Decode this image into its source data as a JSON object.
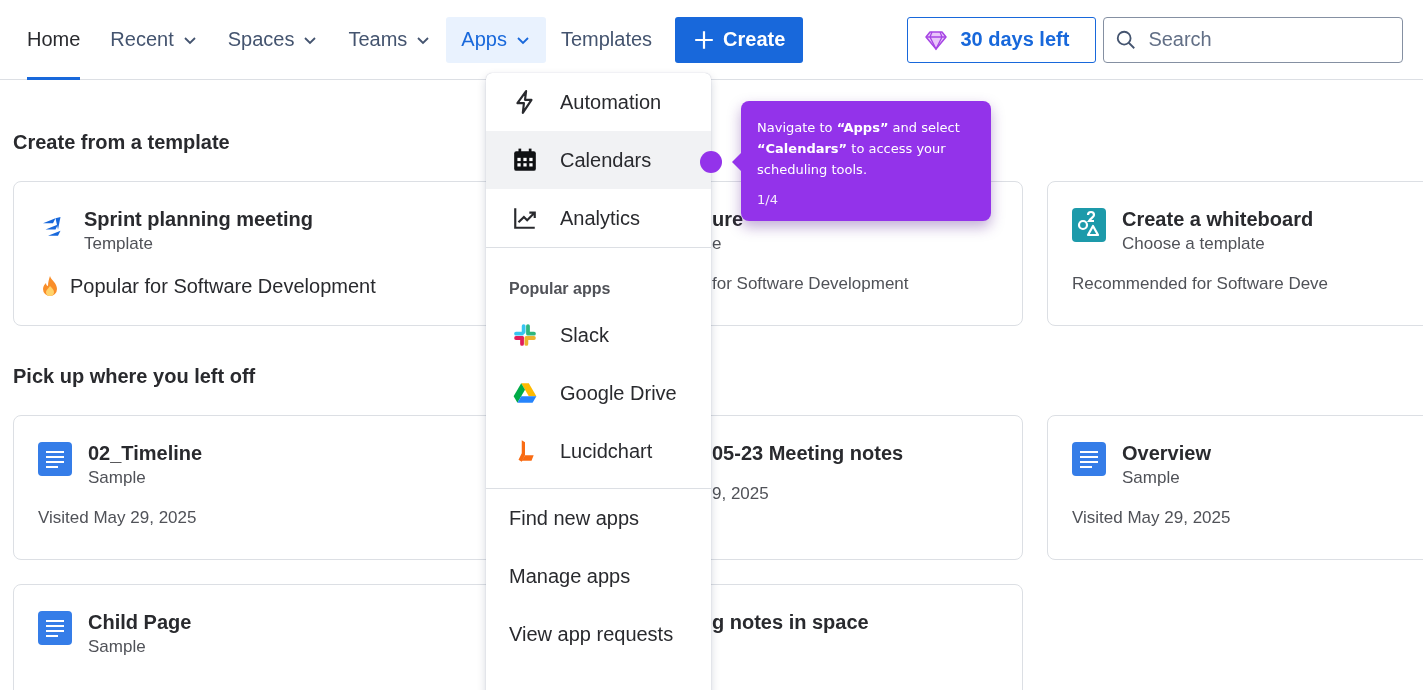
{
  "nav": {
    "items": [
      {
        "label": "Home",
        "caret": false,
        "selected": true,
        "expanded": false
      },
      {
        "label": "Recent",
        "caret": true,
        "selected": false,
        "expanded": false
      },
      {
        "label": "Spaces",
        "caret": true,
        "selected": false,
        "expanded": false
      },
      {
        "label": "Teams",
        "caret": true,
        "selected": false,
        "expanded": false
      },
      {
        "label": "Apps",
        "caret": true,
        "selected": false,
        "expanded": true
      },
      {
        "label": "Templates",
        "caret": false,
        "selected": false,
        "expanded": false
      }
    ],
    "create_button": "Create",
    "trial_badge": "30 days left",
    "search": {
      "placeholder": "Search"
    }
  },
  "sections": [
    {
      "title": "Create from a template",
      "rows": [
        [
          {
            "kind": "template",
            "title": "Sprint planning meeting",
            "subtitle": "Template",
            "footer": "Popular for Software Development",
            "footer_icon": true
          },
          {
            "kind": "hidden",
            "title": "ure",
            "subtitle": "e",
            "footer": "for Software Development",
            "footer_icon": false
          },
          {
            "kind": "whiteboard",
            "title": "Create a whiteboard",
            "subtitle": "Choose a template",
            "footer": "Recommended for Software Deve",
            "footer_icon": false
          }
        ]
      ]
    },
    {
      "title": "Pick up where you left off",
      "rows": [
        [
          {
            "kind": "page",
            "title": "02_Timeline",
            "subtitle": "Sample",
            "footer": "Visited May 29, 2025",
            "footer_icon": false
          },
          {
            "kind": "hidden",
            "title": "05-23 Meeting notes",
            "footer": "9, 2025",
            "footer_icon": false
          },
          {
            "kind": "page",
            "title": "Overview",
            "subtitle": "Sample",
            "footer": "Visited May 29, 2025",
            "footer_icon": false
          }
        ],
        [
          {
            "kind": "page",
            "title": "Child Page",
            "subtitle": "Sample"
          },
          {
            "kind": "hidden",
            "title": "g notes in space"
          }
        ]
      ]
    }
  ],
  "apps_menu": {
    "items": [
      {
        "label": "Automation",
        "selected": false
      },
      {
        "label": "Calendars",
        "selected": true
      },
      {
        "label": "Analytics",
        "selected": false
      }
    ],
    "popular_heading": "Popular apps",
    "popular": [
      {
        "label": "Slack"
      },
      {
        "label": "Google Drive"
      },
      {
        "label": "Lucidchart"
      }
    ],
    "links": [
      "Find new apps",
      "Manage apps",
      "View app requests"
    ]
  },
  "tooltip": {
    "text": "Navigate to **“Apps”** and select **“Calendars”** to access your scheduling tools.",
    "step": "1/4"
  }
}
